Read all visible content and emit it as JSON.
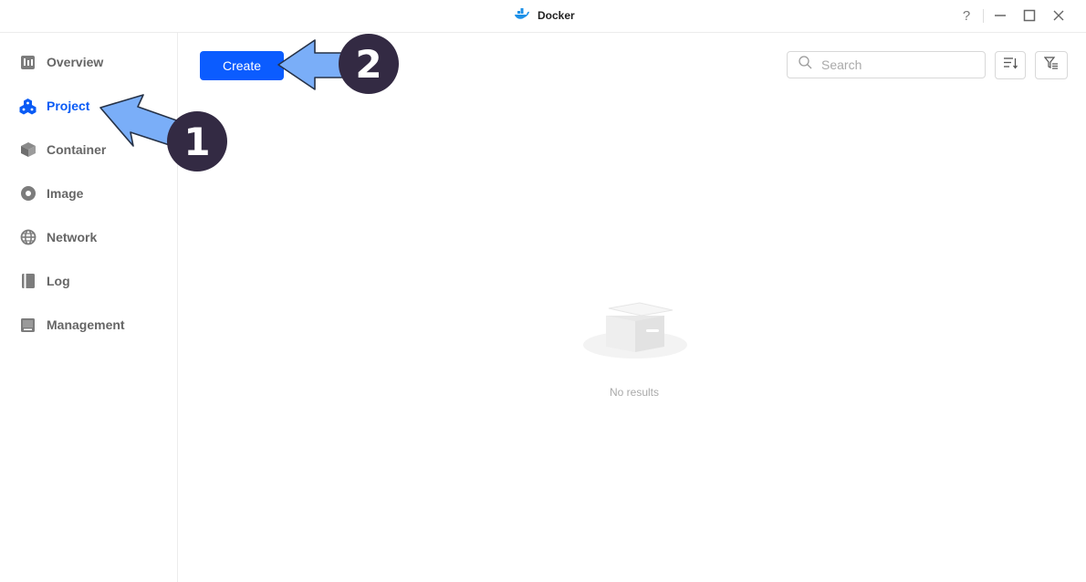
{
  "window": {
    "title": "Docker",
    "help_label": "?",
    "icons": [
      "docker-whale-icon",
      "help-icon",
      "minimize-icon",
      "maximize-icon",
      "close-icon"
    ]
  },
  "sidebar": {
    "items": [
      {
        "label": "Overview",
        "icon": "overview-icon",
        "active": false
      },
      {
        "label": "Project",
        "icon": "project-icon",
        "active": true
      },
      {
        "label": "Container",
        "icon": "container-icon",
        "active": false
      },
      {
        "label": "Image",
        "icon": "image-icon",
        "active": false
      },
      {
        "label": "Network",
        "icon": "network-icon",
        "active": false
      },
      {
        "label": "Log",
        "icon": "log-icon",
        "active": false
      },
      {
        "label": "Management",
        "icon": "management-icon",
        "active": false
      }
    ]
  },
  "toolbar": {
    "create_label": "Create",
    "search_placeholder": "Search",
    "search_value": ""
  },
  "empty_state": {
    "text": "No results"
  },
  "annotations": [
    {
      "number": "1",
      "target": "Project"
    },
    {
      "number": "2",
      "target": "Create"
    }
  ],
  "colors": {
    "accent": "#0b5cff",
    "annotation_arrow": "#7aaef8",
    "annotation_badge": "#332a43"
  }
}
